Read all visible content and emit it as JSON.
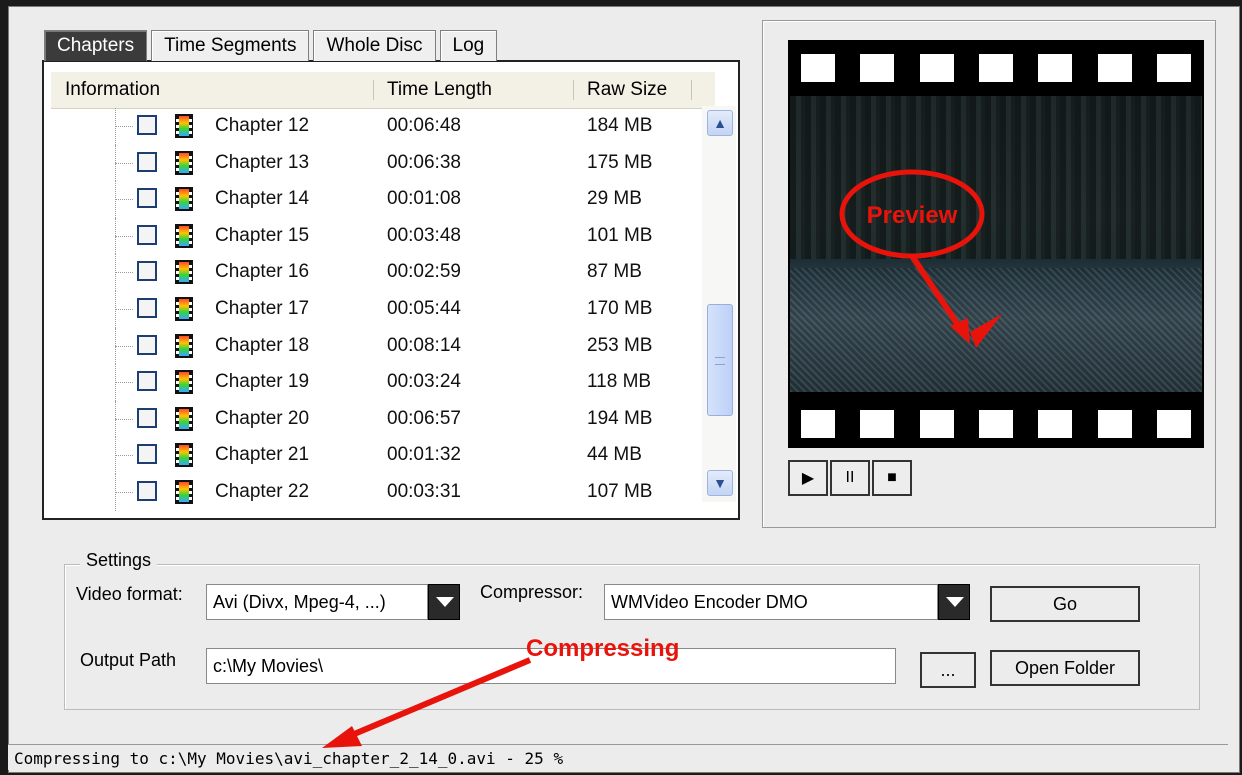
{
  "tabs": [
    "Chapters",
    "Time Segments",
    "Whole Disc",
    "Log"
  ],
  "list": {
    "headers": [
      "Information",
      "Time Length",
      "Raw Size"
    ],
    "rows": [
      {
        "name": "Chapter 12",
        "time": "00:06:48",
        "size": "184 MB"
      },
      {
        "name": "Chapter 13",
        "time": "00:06:38",
        "size": "175 MB"
      },
      {
        "name": "Chapter 14",
        "time": "00:01:08",
        "size": "29 MB"
      },
      {
        "name": "Chapter 15",
        "time": "00:03:48",
        "size": "101 MB"
      },
      {
        "name": "Chapter 16",
        "time": "00:02:59",
        "size": "87 MB"
      },
      {
        "name": "Chapter 17",
        "time": "00:05:44",
        "size": "170 MB"
      },
      {
        "name": "Chapter 18",
        "time": "00:08:14",
        "size": "253 MB"
      },
      {
        "name": "Chapter 19",
        "time": "00:03:24",
        "size": "118 MB"
      },
      {
        "name": "Chapter 20",
        "time": "00:06:57",
        "size": "194 MB"
      },
      {
        "name": "Chapter 21",
        "time": "00:01:32",
        "size": "44 MB"
      },
      {
        "name": "Chapter 22",
        "time": "00:03:31",
        "size": "107 MB"
      }
    ]
  },
  "preview": {
    "annotation": "Preview"
  },
  "player": {
    "play": "▶",
    "pause": "II",
    "stop": "■"
  },
  "settings": {
    "legend": "Settings",
    "video_format_label": "Video format:",
    "video_format_value": "Avi (Divx, Mpeg-4, ...)",
    "compressor_label": "Compressor:",
    "compressor_value": "WMVideo Encoder DMO",
    "go_label": "Go",
    "output_path_label": "Output Path",
    "output_path_value": "c:\\My Movies\\",
    "browse_label": "...",
    "open_folder_label": "Open Folder"
  },
  "annotation_compressing": "Compressing",
  "status_text": "Compressing to c:\\My Movies\\avi_chapter_2_14_0.avi - 25 %",
  "colors": {
    "annotation_red": "#e8140c",
    "tab_active_bg": "#3b3b3b"
  }
}
